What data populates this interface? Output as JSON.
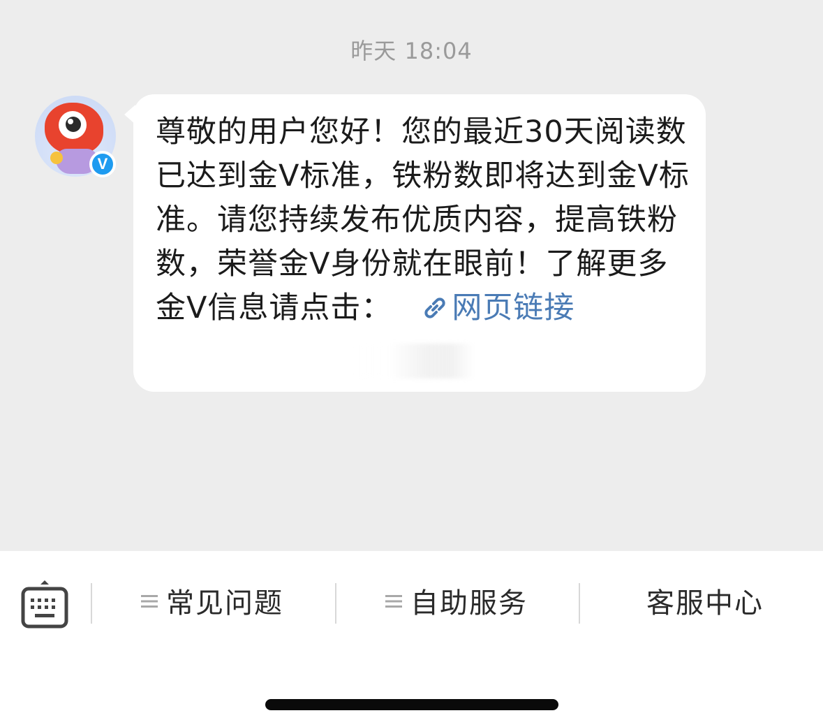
{
  "chat": {
    "timestamp": "昨天 18:04",
    "avatar_badge": "V",
    "message": {
      "text": "尊敬的用户您好！您的最近30天阅读数已达到金V标准，铁粉数即将达到金V标准。请您持续发布优质内容，提高铁粉数，荣誉金V身份就在眼前！了解更多金V信息请点击：",
      "link_label": "网页链接",
      "link_icon": "link-icon"
    }
  },
  "toolbar": {
    "keyboard_icon": "keyboard-icon",
    "items": [
      {
        "label": "常见问题",
        "icon": "menu-lines-icon"
      },
      {
        "label": "自助服务",
        "icon": "menu-lines-icon"
      },
      {
        "label": "客服中心"
      }
    ]
  },
  "colors": {
    "chat_background": "#ededed",
    "bubble": "#ffffff",
    "link": "#4a7bb5",
    "verified_badge": "#1e9bf0",
    "timestamp": "#9a9a9a"
  }
}
